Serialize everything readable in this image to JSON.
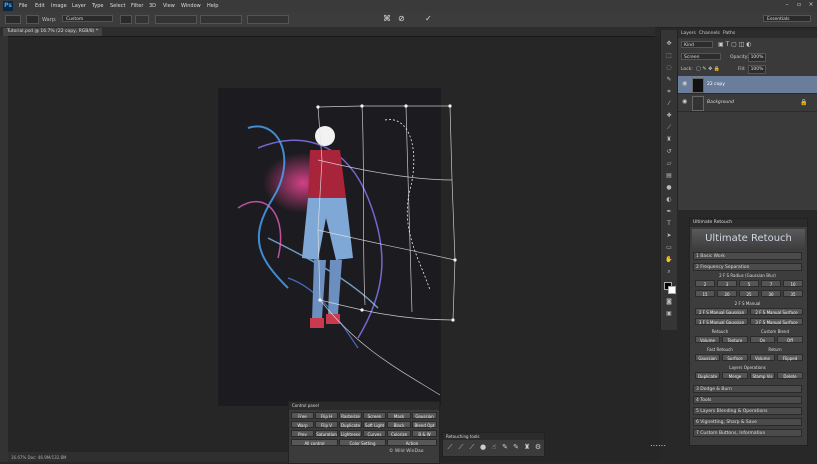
{
  "menubar": {
    "logo": "Ps",
    "items": [
      "File",
      "Edit",
      "Image",
      "Layer",
      "Type",
      "Select",
      "Filter",
      "3D",
      "View",
      "Window",
      "Help"
    ]
  },
  "options": {
    "warp_label": "Warp:",
    "warp_value": "Custom",
    "workspace": "Essentials"
  },
  "document": {
    "tab_title": "Tutorial.psd @ 16.7% (22 copy, RGB/8) *"
  },
  "layers_panel": {
    "tabs": [
      "Layers",
      "Channels",
      "Paths"
    ],
    "kind": "Kind",
    "blend_mode": "Screen",
    "opacity_label": "Opacity:",
    "opacity_value": "100%",
    "lock_label": "Lock:",
    "fill_label": "Fill:",
    "fill_value": "100%",
    "layers": [
      {
        "name": "22 copy"
      },
      {
        "name": "Background"
      }
    ]
  },
  "ultimate_retouch": {
    "header": "Ultimate Retouch",
    "title": "Ultimate Retouch",
    "basic_work": "1 Basic Work",
    "frequency": "2 Frequency Separation",
    "fs_radius_label": "2 F S Radius (Gaussian Blur)",
    "radius_row1": [
      "2",
      "3",
      "5",
      "7",
      "10"
    ],
    "radius_row2": [
      "15",
      "20",
      "25",
      "30",
      "35"
    ],
    "fs_manual_label": "2 F S Manual",
    "manual_buttons": [
      "2 F S Manual Gaussian",
      "2 F S Manual Surface",
      "3 F S Manual Gaussian",
      "3 F S Manual Surface"
    ],
    "retouch_label": "Retouch",
    "custom_blend_label": "Custom Blend",
    "retouch_buttons": [
      "Volume",
      "Texture",
      "On",
      "Off"
    ],
    "fast_retouch_label": "Fast Retouch",
    "return_label": "Return",
    "fast_buttons": [
      "Gaussian",
      "Surface",
      "Volume",
      "Flipped"
    ],
    "layers_ops_label": "Layers Operations",
    "ops_buttons": [
      "Duplicate",
      "Merge",
      "Stamp Vis",
      "Delete"
    ],
    "sections": [
      "3 Dodge & Burn",
      "4 Tools",
      "5 Layers Blending & Operations",
      "6 Vignetting, Sharp & Save",
      "7 Custom Buttons, Information"
    ]
  },
  "control_panel": {
    "header": "Control panel",
    "rows": [
      [
        "Free Transf",
        "Flip H",
        "Rasterize",
        "Screen",
        "Mask",
        "Gaussian"
      ],
      [
        "Warp",
        "Flip V",
        "Duplicate",
        "Soft Light",
        "Black Mask",
        "Blend Opt"
      ],
      [
        "Prev",
        "Saturation",
        "Lightness",
        "Curves",
        "Colorize",
        "B & W"
      ]
    ],
    "bottom": [
      "All control",
      "Color Setting",
      "Action"
    ],
    "credit": "© Wild WinDao"
  },
  "retouching_tools": {
    "header": "Retouching tools"
  },
  "statusbar": {
    "text": "16.67%   Doc: 46.9M/132.8M"
  },
  "colors": {
    "ps_blue": "#31a8ff",
    "selected_layer": "#6a7e9c",
    "panel_bg": "#3a3a3a"
  }
}
